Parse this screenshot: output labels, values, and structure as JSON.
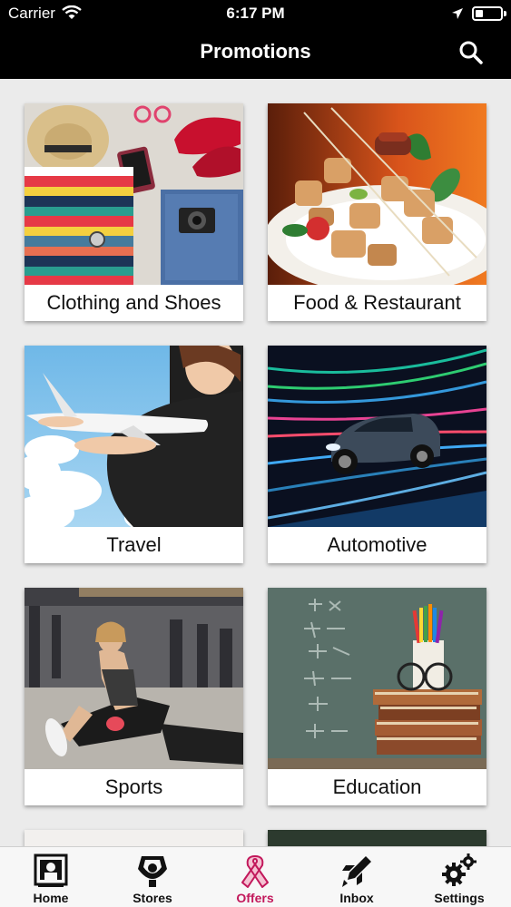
{
  "status_bar": {
    "carrier": "Carrier",
    "time": "6:17 PM"
  },
  "header": {
    "title": "Promotions",
    "search_icon": "search-icon"
  },
  "categories": [
    {
      "label": "Clothing and Shoes",
      "image": "clothing-image"
    },
    {
      "label": "Food & Restaurant",
      "image": "food-image"
    },
    {
      "label": "Travel",
      "image": "travel-image"
    },
    {
      "label": "Automotive",
      "image": "automotive-image"
    },
    {
      "label": "Sports",
      "image": "sports-image"
    },
    {
      "label": "Education",
      "image": "education-image"
    }
  ],
  "tab_bar": {
    "active_color": "#c2185b",
    "items": [
      {
        "label": "Home",
        "icon": "home-icon"
      },
      {
        "label": "Stores",
        "icon": "stores-icon"
      },
      {
        "label": "Offers",
        "icon": "ribbon-icon",
        "active": true
      },
      {
        "label": "Inbox",
        "icon": "inbox-icon"
      },
      {
        "label": "Settings",
        "icon": "settings-icon"
      }
    ]
  }
}
